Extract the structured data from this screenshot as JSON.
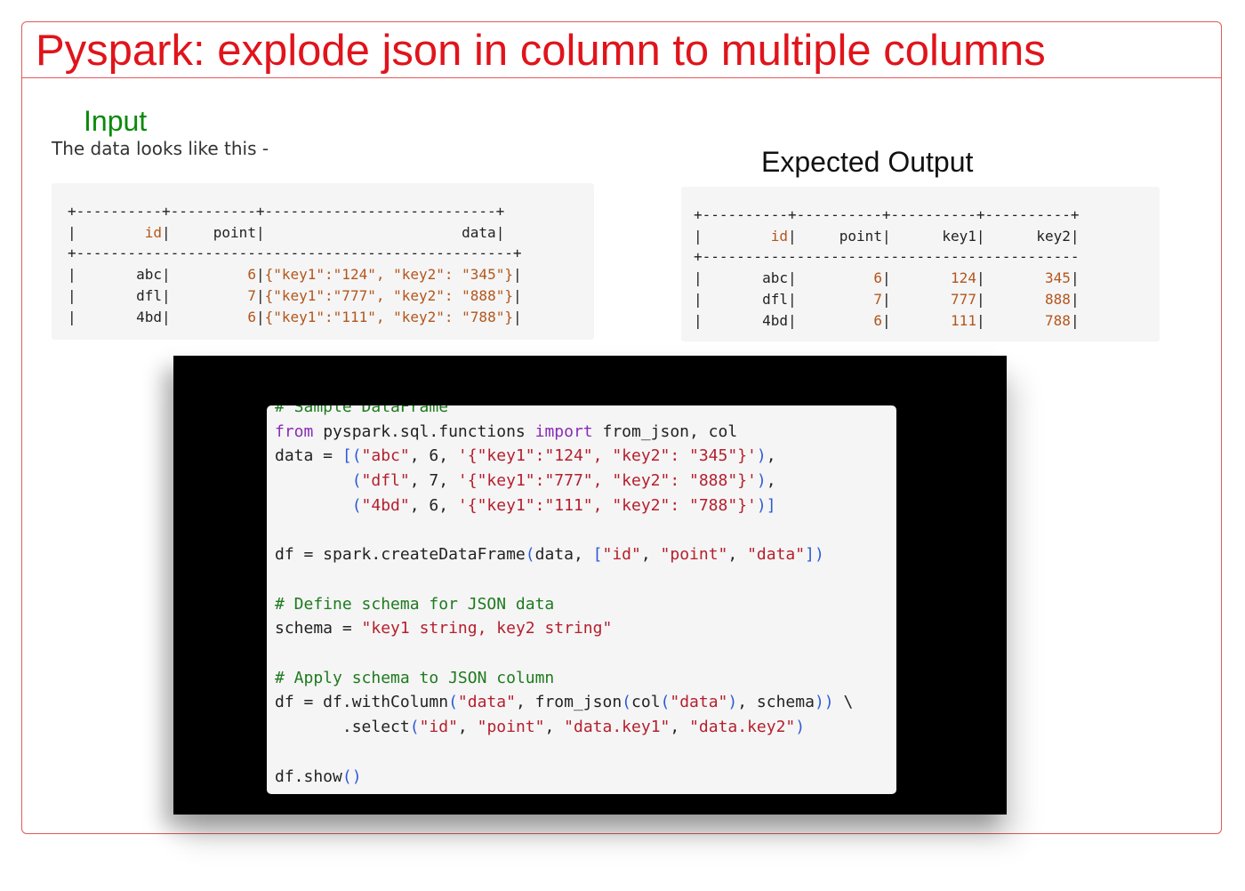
{
  "title": "Pyspark: explode json in column to multiple columns",
  "input": {
    "heading": "Input",
    "caption": "The data looks like this -",
    "table_lines": [
      "+----------+----------+---------------------------+",
      "|        id|     point|                       data|",
      "+---------------------------------------------------+",
      "|       abc|         6|{\"key1\":\"124\", \"key2\": \"345\"}|",
      "|       dfl|         7|{\"key1\":\"777\", \"key2\": \"888\"}|",
      "|       4bd|         6|{\"key1\":\"111\", \"key2\": \"788\"}|"
    ]
  },
  "output": {
    "heading": "Expected Output",
    "table_lines": [
      "+----------+----------+----------+----------+",
      "|        id|     point|      key1|      key2|",
      "+--------------------------------------------",
      "|       abc|         6|       124|       345|",
      "|       dfl|         7|       777|       888|",
      "|       4bd|         6|       111|       788|"
    ]
  },
  "code": {
    "lines": [
      "# Sample DataFrame",
      "from pyspark.sql.functions import from_json, col",
      "data = [(\"abc\", 6, '{\"key1\":\"124\", \"key2\": \"345\"}'),",
      "        (\"dfl\", 7, '{\"key1\":\"777\", \"key2\": \"888\"}'),",
      "        (\"4bd\", 6, '{\"key1\":\"111\", \"key2\": \"788\"}')]",
      "",
      "df = spark.createDataFrame(data, [\"id\", \"point\", \"data\"])",
      "",
      "# Define schema for JSON data",
      "schema = \"key1 string, key2 string\"",
      "",
      "# Apply schema to JSON column",
      "df = df.withColumn(\"data\", from_json(col(\"data\"), schema)) \\",
      "       .select(\"id\", \"point\", \"data.key1\", \"data.key2\")",
      "",
      "df.show()"
    ]
  },
  "colors": {
    "title": "#e0141b",
    "input_heading": "#0a8a0a",
    "frame_border": "#e05a5a",
    "code_keyword": "#8a2bb8",
    "code_string": "#b51f2d",
    "code_comment": "#1e7a1e",
    "code_bracket": "#2d5bd6",
    "table_value": "#b3561c"
  }
}
